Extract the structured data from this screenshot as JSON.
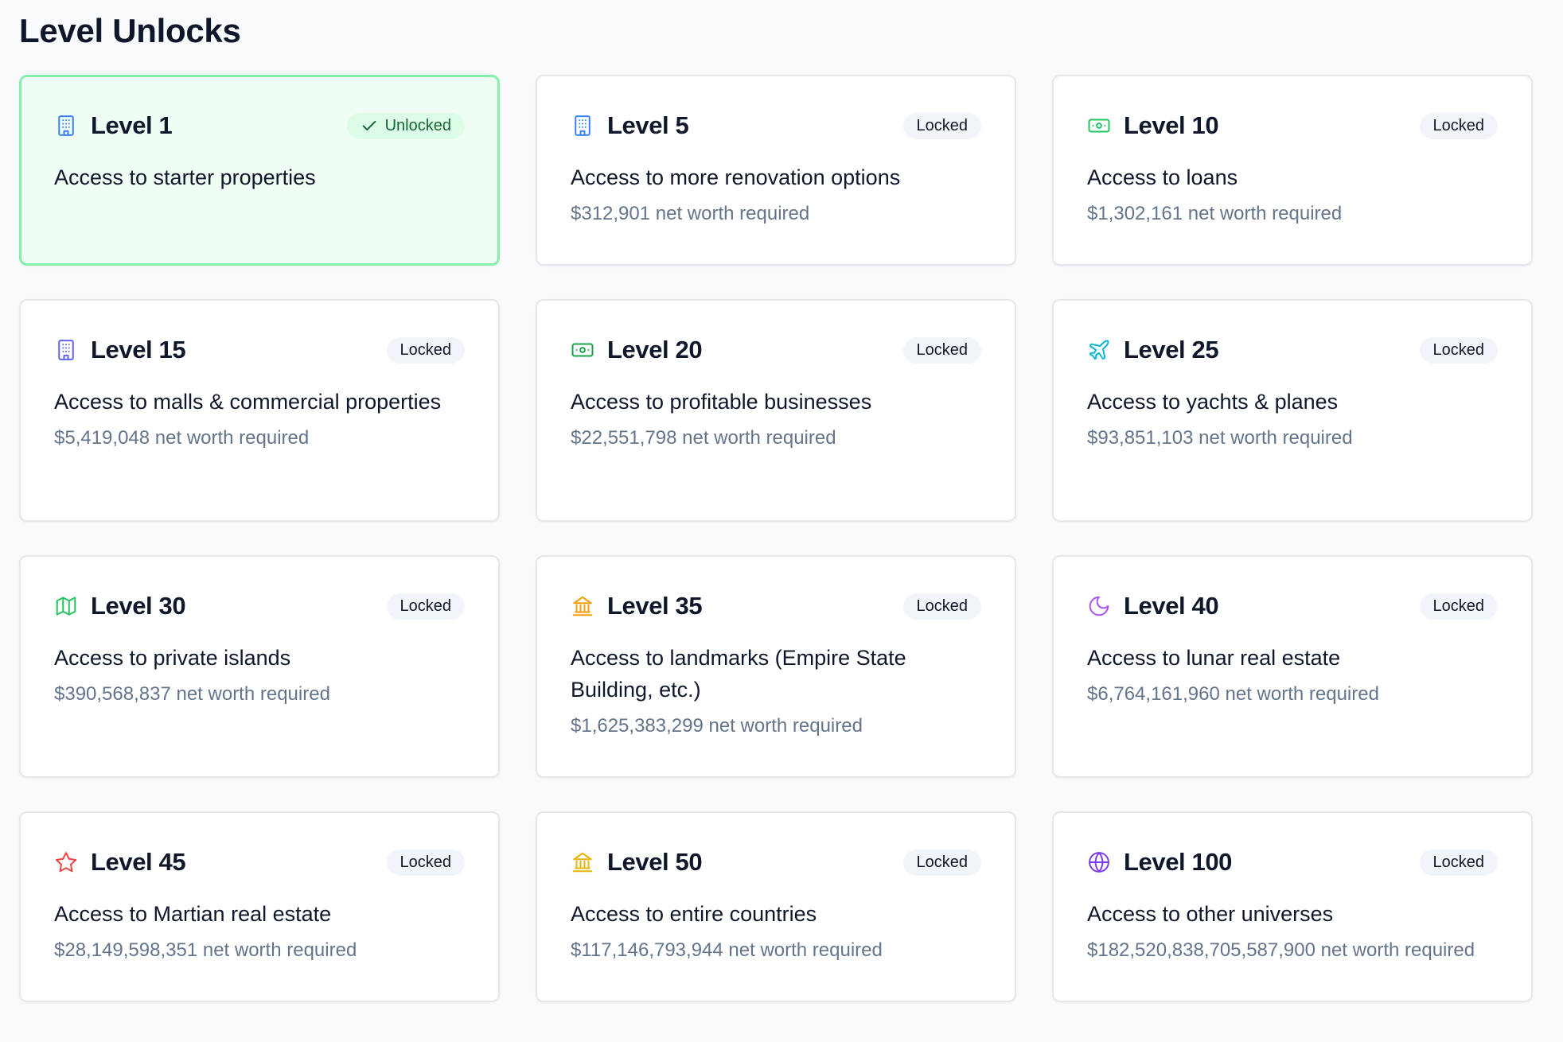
{
  "page": {
    "title": "Level Unlocks"
  },
  "levels": [
    {
      "title": "Level 1",
      "status": "Unlocked",
      "description": "Access to starter properties",
      "requirement": "",
      "icon": "building-icon",
      "icon_color": "#3b82f6"
    },
    {
      "title": "Level 5",
      "status": "Locked",
      "description": "Access to more renovation options",
      "requirement": "$312,901 net worth required",
      "icon": "building-icon",
      "icon_color": "#3b82f6"
    },
    {
      "title": "Level 10",
      "status": "Locked",
      "description": "Access to loans",
      "requirement": "$1,302,161 net worth required",
      "icon": "banknote-icon",
      "icon_color": "#22c55e"
    },
    {
      "title": "Level 15",
      "status": "Locked",
      "description": "Access to malls & commercial properties",
      "requirement": "$5,419,048 net worth required",
      "icon": "building-icon",
      "icon_color": "#6366f1"
    },
    {
      "title": "Level 20",
      "status": "Locked",
      "description": "Access to profitable businesses",
      "requirement": "$22,551,798 net worth required",
      "icon": "banknote-icon",
      "icon_color": "#16a34a"
    },
    {
      "title": "Level 25",
      "status": "Locked",
      "description": "Access to yachts & planes",
      "requirement": "$93,851,103 net worth required",
      "icon": "plane-icon",
      "icon_color": "#06b6d4"
    },
    {
      "title": "Level 30",
      "status": "Locked",
      "description": "Access to private islands",
      "requirement": "$390,568,837 net worth required",
      "icon": "map-icon",
      "icon_color": "#22c55e"
    },
    {
      "title": "Level 35",
      "status": "Locked",
      "description": "Access to landmarks (Empire State Building, etc.)",
      "requirement": "$1,625,383,299 net worth required",
      "icon": "landmark-icon",
      "icon_color": "#f59e0b"
    },
    {
      "title": "Level 40",
      "status": "Locked",
      "description": "Access to lunar real estate",
      "requirement": "$6,764,161,960 net worth required",
      "icon": "moon-icon",
      "icon_color": "#a855f7"
    },
    {
      "title": "Level 45",
      "status": "Locked",
      "description": "Access to Martian real estate",
      "requirement": "$28,149,598,351 net worth required",
      "icon": "star-icon",
      "icon_color": "#ef4444"
    },
    {
      "title": "Level 50",
      "status": "Locked",
      "description": "Access to entire countries",
      "requirement": "$117,146,793,944 net worth required",
      "icon": "landmark-icon",
      "icon_color": "#eab308"
    },
    {
      "title": "Level 100",
      "status": "Locked",
      "description": "Access to other universes",
      "requirement": "$182,520,838,705,587,900 net worth required",
      "icon": "globe-icon",
      "icon_color": "#7c3aed"
    }
  ]
}
